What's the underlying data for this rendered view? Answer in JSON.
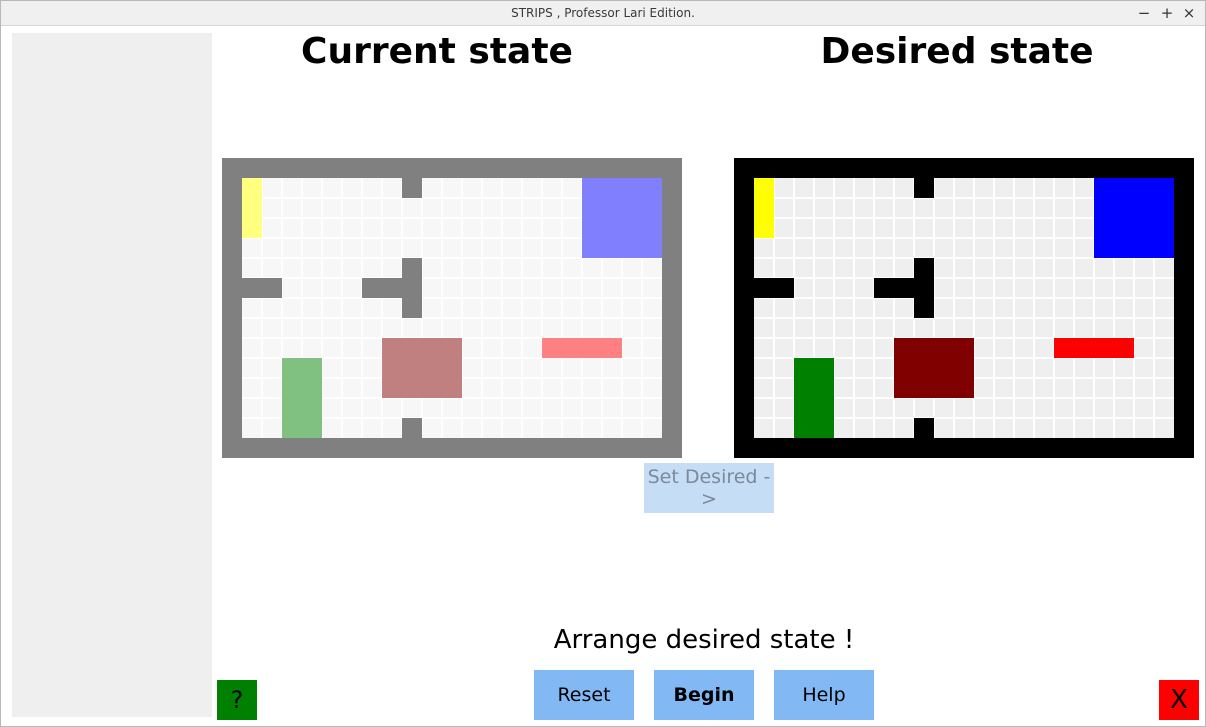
{
  "window": {
    "title": "STRIPS , Professor Lari Edition.",
    "minimize_glyph": "−",
    "maximize_glyph": "+",
    "close_glyph": "×"
  },
  "current": {
    "title": "Current state",
    "wall_color": "#808080",
    "floor_color": "#f7f7f7",
    "grid_line_color": "#ffffff",
    "objects": [
      {
        "name": "yellow-object",
        "color": "#ffff80"
      },
      {
        "name": "blue-object",
        "color": "#8080ff"
      },
      {
        "name": "pink-object",
        "color": "#ff8080"
      },
      {
        "name": "maroon-object",
        "color": "#c08080"
      },
      {
        "name": "green-object",
        "color": "#80c080"
      }
    ]
  },
  "desired": {
    "title": "Desired state",
    "wall_color": "#000000",
    "floor_color": "#efefef",
    "grid_line_color": "#ffffff",
    "objects": [
      {
        "name": "yellow-object",
        "color": "#ffff00"
      },
      {
        "name": "blue-object",
        "color": "#0000ff"
      },
      {
        "name": "red-object",
        "color": "#ff0000"
      },
      {
        "name": "maroon-object",
        "color": "#800000"
      },
      {
        "name": "green-object",
        "color": "#008000"
      }
    ]
  },
  "set_desired_label": "Set Desired ->",
  "message": "Arrange desired state !",
  "buttons": {
    "reset": "Reset",
    "begin": "Begin",
    "help": "Help",
    "question": "?",
    "exit": "X"
  },
  "colors": {
    "button_blue": "#82b9f5",
    "button_disabled": "#c6ddf6",
    "question_green": "#008000",
    "exit_red": "#ff0000"
  }
}
